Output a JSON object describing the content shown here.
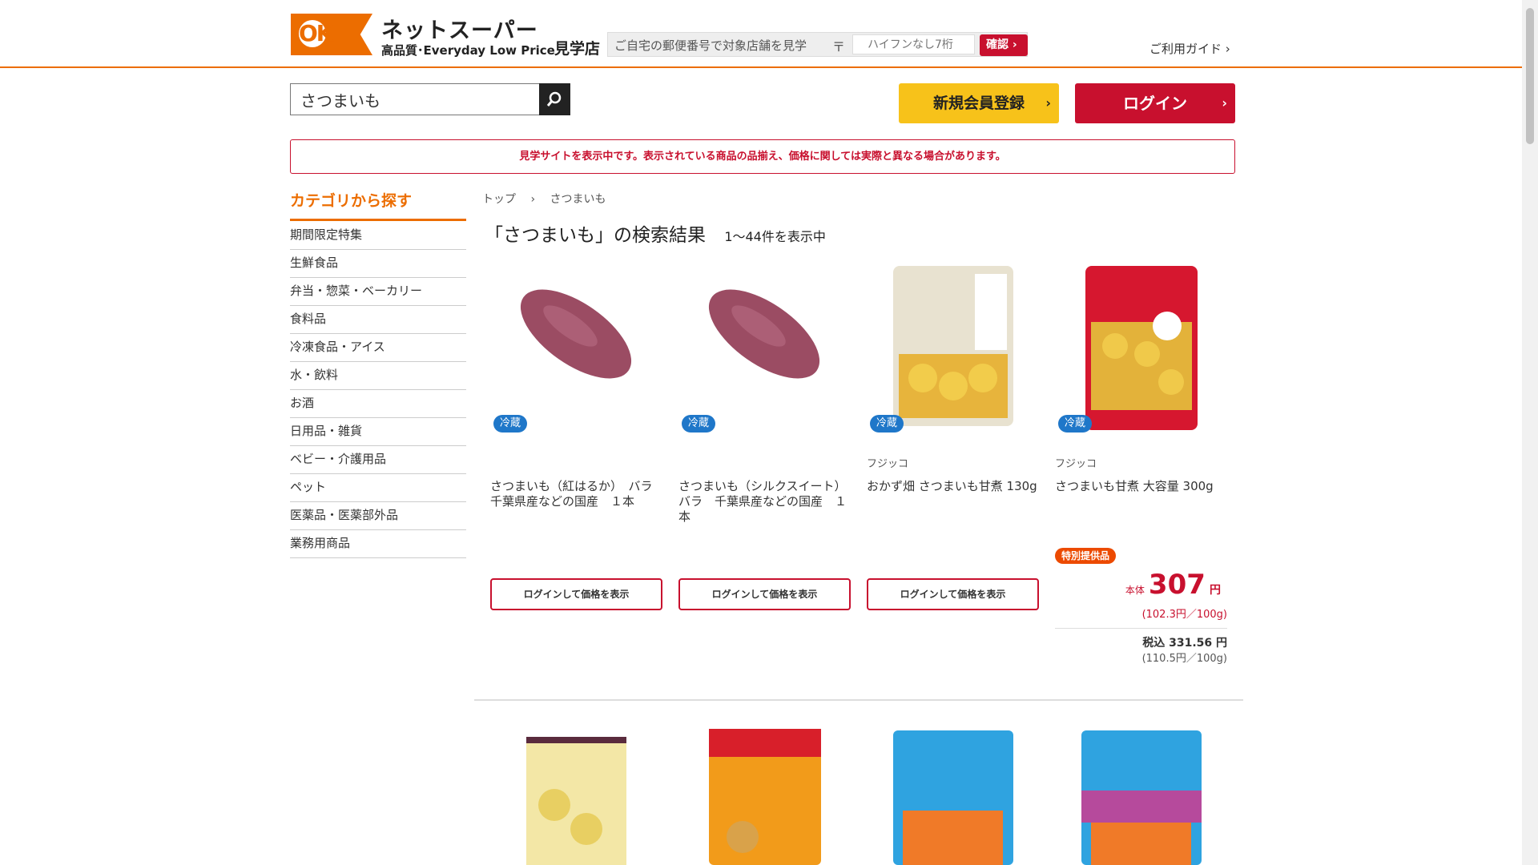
{
  "header": {
    "logo_mark": "OK",
    "logo_title": "ネットスーパー",
    "logo_sub": "高品質･Everyday Low Price",
    "store_label": "見学店",
    "postal_text": "ご自宅の郵便番号で対象店舗を見学",
    "postal_mark": "〒",
    "postal_placeholder": "ハイフンなし7桁",
    "confirm_label": "確認",
    "guide_label": "ご利用ガイド ›"
  },
  "search": {
    "value": "さつまいも"
  },
  "buttons": {
    "register": "新規会員登録",
    "login": "ログイン",
    "arrow": "›"
  },
  "notice": "見学サイトを表示中です。表示されている商品の品揃え、価格に関しては実際と異なる場合があります。",
  "sidebar": {
    "title": "カテゴリから探す",
    "items": [
      "期間限定特集",
      "生鮮食品",
      "弁当・惣菜・ベーカリー",
      "食料品",
      "冷凍食品・アイス",
      "水・飲料",
      "お酒",
      "日用品・雑貨",
      "ベビー・介護用品",
      "ペット",
      "医薬品・医薬部外品",
      "業務用商品"
    ]
  },
  "breadcrumb": {
    "top": "トップ",
    "sep": "›",
    "current": "さつまいも"
  },
  "results": {
    "title": "「さつまいも」の検索結果",
    "count": "1〜44件を表示中"
  },
  "products": [
    {
      "badge": "冷蔵",
      "brand": "",
      "name": "さつまいも（紅はるか）　バラ　千葉県産などの国産　１本",
      "action": "ログインして価格を表示"
    },
    {
      "badge": "冷蔵",
      "brand": "",
      "name": "さつまいも（シルクスイート）　バラ　千葉県産などの国産　１本",
      "action": "ログインして価格を表示"
    },
    {
      "badge": "冷蔵",
      "brand": "フジッコ",
      "name": "おかず畑 さつまいも甘煮 130g",
      "action": "ログインして価格を表示"
    },
    {
      "badge": "冷蔵",
      "brand": "フジッコ",
      "name": "さつまいも甘煮 大容量 300g",
      "special": "特別提供品",
      "price_label": "本体",
      "price": "307",
      "price_unit": "円",
      "price_per": "(102.3円／100g)",
      "taxin": "税込 331.56 円",
      "taxin_per": "(110.5円／100g)"
    }
  ],
  "colors": {
    "brand_orange": "#ec6d00",
    "brand_red": "#c8102e",
    "yellow": "#f7c21a",
    "cold_blue": "#1f77c9"
  }
}
